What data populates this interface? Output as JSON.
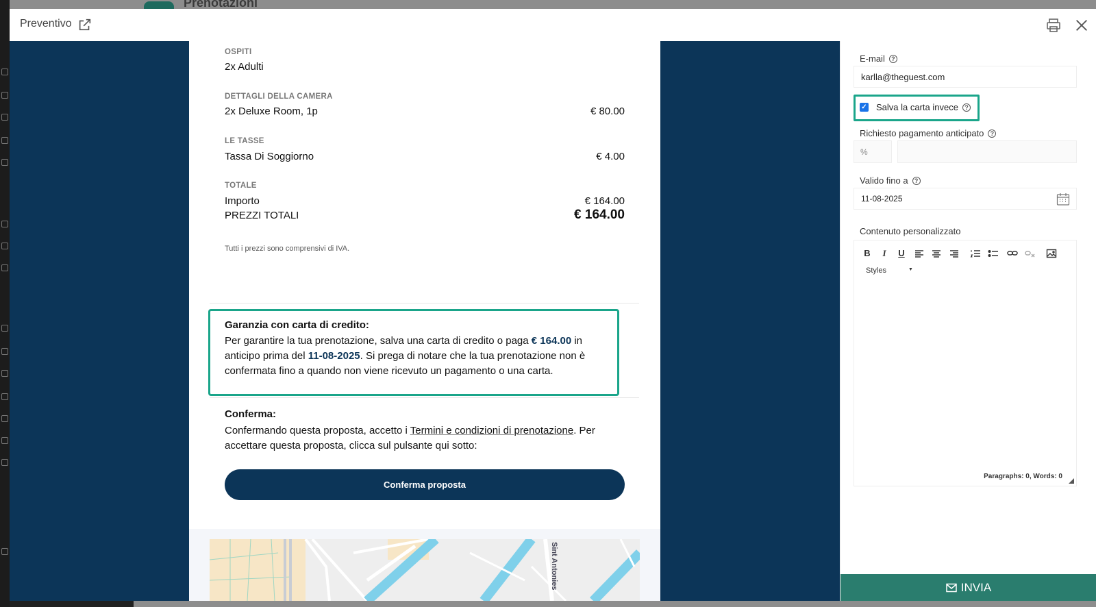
{
  "background_app": {
    "page_title": "Prenotazioni"
  },
  "modal": {
    "title": "Preventivo",
    "icons": {
      "external": "external-link-icon",
      "print": "print-icon",
      "close": "close-icon"
    }
  },
  "preview": {
    "guests": {
      "label": "OSPITI",
      "value": "2x Adulti"
    },
    "room": {
      "label": "DETTAGLI DELLA CAMERA",
      "item": "2x Deluxe Room, 1p",
      "price": "€ 80.00"
    },
    "taxes": {
      "label": "LE TASSE",
      "item": "Tassa Di Soggiorno",
      "price": "€ 4.00"
    },
    "total": {
      "label": "TOTALE",
      "amount_label": "Importo",
      "amount": "€ 164.00",
      "grand_label": "PREZZI TOTALI",
      "grand": "€ 164.00"
    },
    "vat_note": "Tutti i prezzi sono comprensivi di IVA.",
    "guarantee": {
      "title": "Garanzia con carta di credito:",
      "text_1": "Per garantire la tua prenotazione, salva una carta di credito o paga ",
      "amount": "€ 164.00",
      "text_2": " in anticipo prima del ",
      "date": "11-08-2025",
      "text_3": ". Si prega di notare che la tua prenotazione non è confermata fino a quando non viene ricevuto un pagamento o una carta."
    },
    "confirm": {
      "title": "Conferma:",
      "text_1": "Confermando questa proposta, accetto i ",
      "link": "Termini e condizioni di prenotazione",
      "text_2": ". Per accettare questa proposta, clicca sul pulsante qui sotto:",
      "button": "Conferma proposta"
    },
    "map": {
      "street_label": "Sint Antonies"
    }
  },
  "form": {
    "email": {
      "label": "E-mail",
      "value": "karlla@theguest.com"
    },
    "save_card": {
      "label": "Salva la carta invece",
      "checked": true
    },
    "prepayment": {
      "label": "Richiesto pagamento anticipato",
      "unit": "%",
      "value": ""
    },
    "valid_until": {
      "label": "Valido fino a",
      "value": "11-08-2025"
    },
    "custom_content": {
      "label": "Contenuto personalizzato",
      "styles_label": "Styles",
      "status": "Paragraphs: 0, Words: 0"
    },
    "send_button": "INVIA"
  },
  "colors": {
    "navy": "#0c3558",
    "teal_highlight": "#1aa58a",
    "send_green": "#2a7d6e",
    "checkbox_blue": "#1a73e8"
  }
}
